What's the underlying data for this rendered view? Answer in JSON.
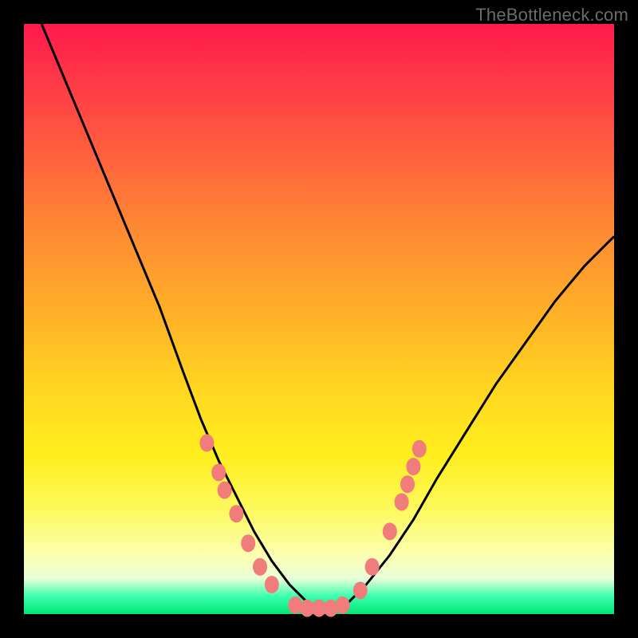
{
  "watermark": "TheBottleneck.com",
  "chart_data": {
    "type": "line",
    "title": "",
    "xlabel": "",
    "ylabel": "",
    "xlim": [
      0,
      100
    ],
    "ylim": [
      0,
      100
    ],
    "series": [
      {
        "name": "bottleneck-curve",
        "x": [
          3,
          8,
          13,
          18,
          23,
          27,
          30,
          33,
          36,
          39,
          42,
          45,
          48,
          50,
          52,
          55,
          58,
          62,
          66,
          70,
          75,
          80,
          85,
          90,
          95,
          100
        ],
        "y": [
          100,
          88,
          76,
          64,
          52,
          41,
          33,
          26,
          20,
          14,
          9,
          5,
          2,
          1,
          1,
          2,
          5,
          10,
          16,
          23,
          31,
          39,
          46,
          53,
          59,
          64
        ]
      }
    ],
    "markers": [
      {
        "x": 31,
        "y": 29
      },
      {
        "x": 33,
        "y": 24
      },
      {
        "x": 34,
        "y": 21
      },
      {
        "x": 36,
        "y": 17
      },
      {
        "x": 38,
        "y": 12
      },
      {
        "x": 40,
        "y": 8
      },
      {
        "x": 42,
        "y": 5
      },
      {
        "x": 46,
        "y": 1.5
      },
      {
        "x": 48,
        "y": 1
      },
      {
        "x": 50,
        "y": 1
      },
      {
        "x": 52,
        "y": 1
      },
      {
        "x": 54,
        "y": 1.5
      },
      {
        "x": 57,
        "y": 4
      },
      {
        "x": 59,
        "y": 8
      },
      {
        "x": 62,
        "y": 14
      },
      {
        "x": 64,
        "y": 19
      },
      {
        "x": 65,
        "y": 22
      },
      {
        "x": 66,
        "y": 25
      },
      {
        "x": 67,
        "y": 28
      }
    ],
    "marker_color": "#f07c7c",
    "curve_color": "#000000",
    "background_gradient": [
      "#ff1a4d",
      "#ffd91f",
      "#00e673"
    ]
  }
}
